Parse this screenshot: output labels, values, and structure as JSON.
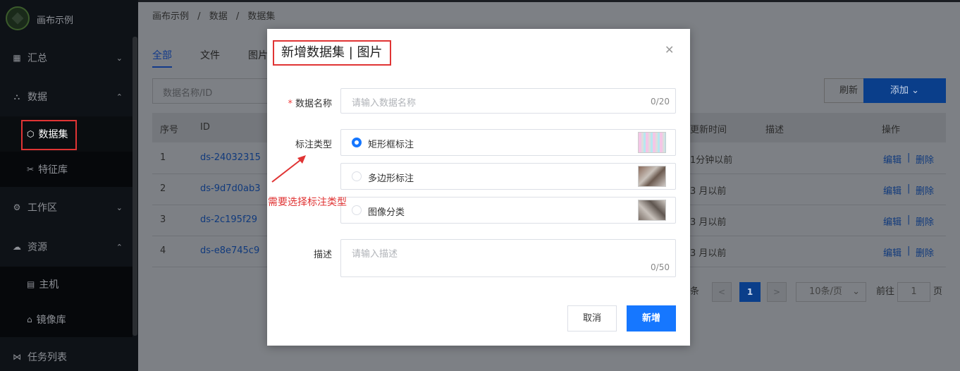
{
  "app": {
    "title": "画布示例"
  },
  "sidebar": {
    "items": [
      {
        "label": "汇总"
      },
      {
        "label": "数据"
      },
      {
        "label": "数据集"
      },
      {
        "label": "特征库"
      },
      {
        "label": "工作区"
      },
      {
        "label": "资源"
      },
      {
        "label": "主机"
      },
      {
        "label": "镜像库"
      },
      {
        "label": "任务列表"
      }
    ]
  },
  "breadcrumb": [
    "画布示例",
    "/",
    "数据",
    "/",
    "数据集"
  ],
  "tabs": [
    "全部",
    "文件",
    "图片"
  ],
  "search": {
    "placeholder": "数据名称/ID"
  },
  "toolbar": {
    "refresh": "刷新",
    "add": "添加"
  },
  "table": {
    "headers": {
      "no": "序号",
      "id": "ID",
      "updated": "更新时间",
      "desc": "描述",
      "ops": "操作"
    },
    "rows": [
      {
        "no": "1",
        "id": "ds-24032315",
        "updated": "1分钟以前",
        "edit": "编辑",
        "sep": "|",
        "del": "删除"
      },
      {
        "no": "2",
        "id": "ds-9d7d0ab3",
        "updated": "3 月以前",
        "edit": "编辑",
        "sep": "|",
        "del": "删除"
      },
      {
        "no": "3",
        "id": "ds-2c195f29",
        "updated": "3 月以前",
        "edit": "编辑",
        "sep": "|",
        "del": "删除"
      },
      {
        "no": "4",
        "id": "ds-e8e745c9",
        "updated": "3 月以前",
        "edit": "编辑",
        "sep": "|",
        "del": "删除"
      }
    ]
  },
  "pagination": {
    "total_suffix": "条",
    "current": "1",
    "page_size": "10条/页",
    "goto_label": "前往",
    "goto_value": "1",
    "page_suffix": "页"
  },
  "dialog": {
    "title": "新增数据集 | 图片",
    "name_label": "数据名称",
    "name_placeholder": "请输入数据名称",
    "name_count": "0/20",
    "type_label": "标注类型",
    "options": [
      {
        "label": "矩形框标注",
        "selected": true
      },
      {
        "label": "多边形标注",
        "selected": false
      },
      {
        "label": "图像分类",
        "selected": false
      }
    ],
    "desc_label": "描述",
    "desc_placeholder": "请输入描述",
    "desc_count": "0/50",
    "cancel": "取消",
    "submit": "新增"
  },
  "annotation": {
    "note": "需要选择标注类型",
    "color": "#e03434"
  },
  "colors": {
    "primary": "#1677ff",
    "required": "#f03e3e"
  }
}
